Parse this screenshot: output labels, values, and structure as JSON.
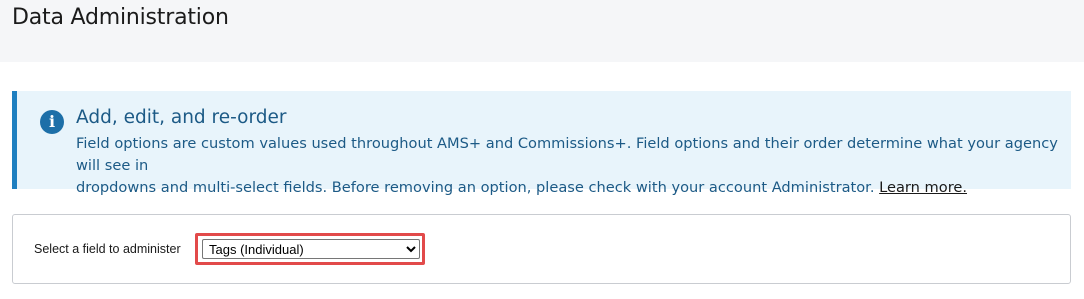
{
  "header": {
    "title": "Data Administration"
  },
  "banner": {
    "icon": "info-icon",
    "icon_glyph": "i",
    "heading": "Add, edit, and re-order",
    "body_line1": "Field options are custom values used throughout AMS+ and Commissions+. Field options and their order determine what your agency will see in",
    "body_line2": "dropdowns and multi-select fields. Before removing an option, please check with your account Administrator.",
    "link_text": "Learn more.",
    "colors": {
      "background": "#e8f4fb",
      "accent": "#1e7fc0"
    }
  },
  "field_selector": {
    "label": "Select a field to administer",
    "selected_value": "Tags (Individual)",
    "highlight_color": "#e24a4a"
  }
}
